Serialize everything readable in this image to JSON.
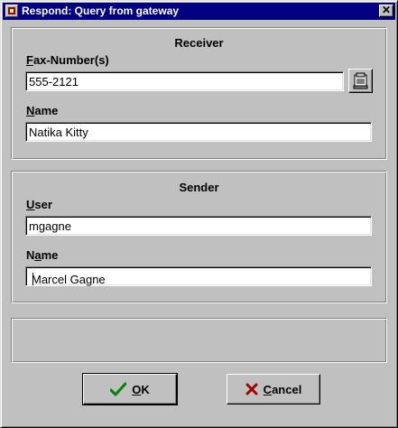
{
  "window": {
    "title": "Respond: Query from gateway",
    "close_glyph": "✕"
  },
  "receiver": {
    "group_title": "Receiver",
    "fax_label_accel": "F",
    "fax_label_rest": "ax-Number(s)",
    "fax_value": "555-2121",
    "name_label_accel": "N",
    "name_label_rest": "ame",
    "name_value": "Natika Kitty",
    "phonebook_icon": "fax-phonebook-icon"
  },
  "sender": {
    "group_title": "Sender",
    "user_label_accel": "U",
    "user_label_rest": "ser",
    "user_value": "mgagne",
    "name_label_pre": "N",
    "name_label_accel": "a",
    "name_label_rest": "me",
    "name_value": "Marcel Gagne"
  },
  "status": {
    "text": ""
  },
  "buttons": {
    "ok_accel": "O",
    "ok_rest": "K",
    "ok_icon": "checkmark-icon",
    "cancel_accel": "C",
    "cancel_rest": "ancel",
    "cancel_icon": "x-icon"
  },
  "colors": {
    "titlebar": "#000080",
    "face": "#c0c0c0",
    "ok_check": "#008000",
    "cancel_x": "#a00000"
  }
}
